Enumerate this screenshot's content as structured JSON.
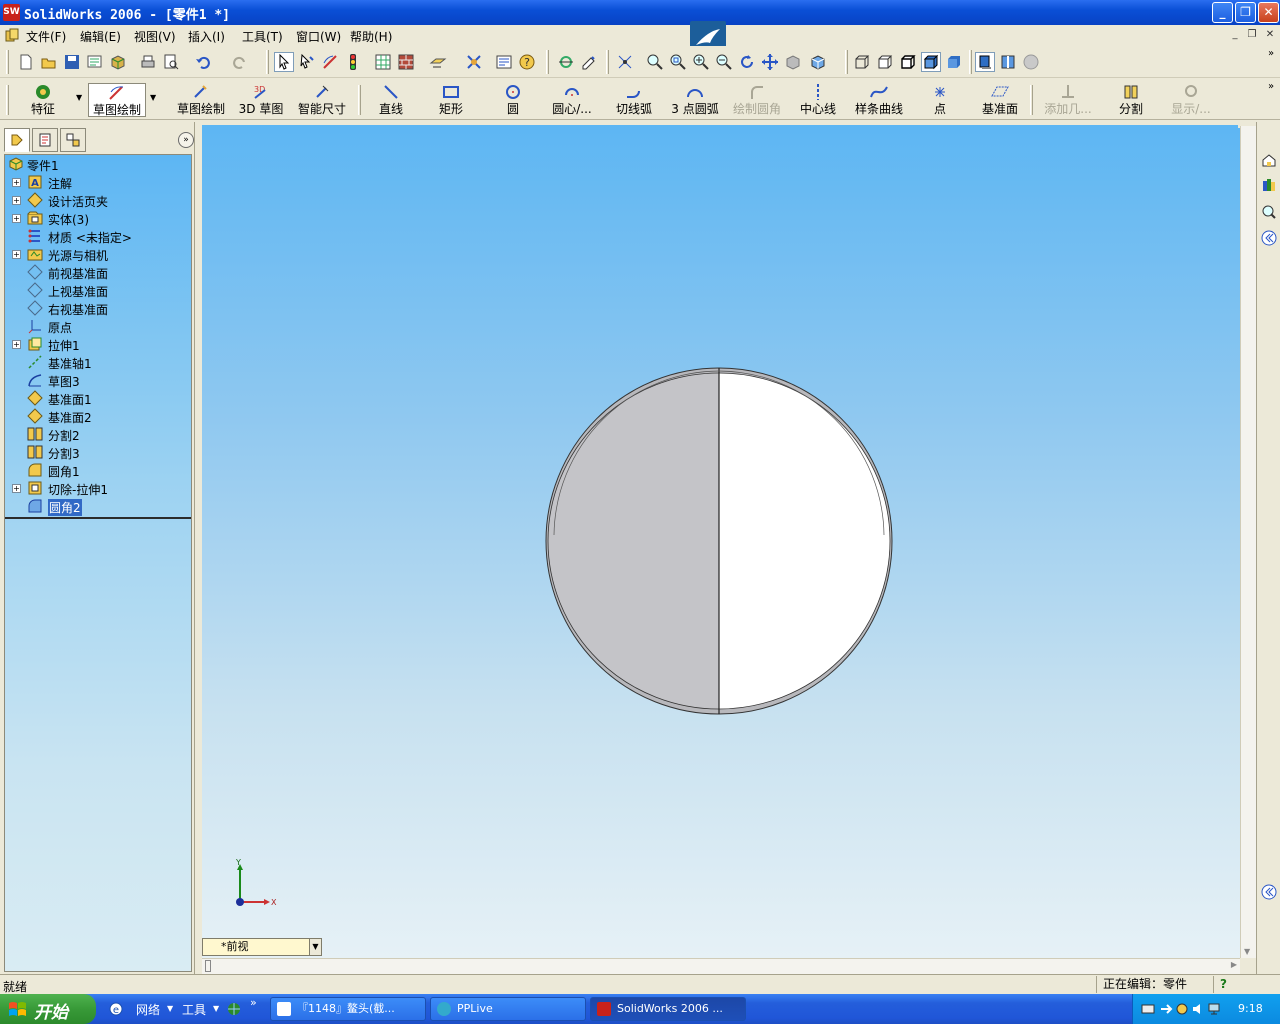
{
  "window": {
    "title": "SolidWorks 2006 - [零件1 *]",
    "logo_text": "SW"
  },
  "menu": {
    "items": [
      "文件(F)",
      "编辑(E)",
      "视图(V)",
      "插入(I)",
      "工具(T)",
      "窗口(W)",
      "帮助(H)"
    ]
  },
  "command_manager": {
    "buttons": [
      {
        "label": "特征",
        "enabled": true
      },
      {
        "label": "草图绘制",
        "enabled": true,
        "selected": true
      },
      {
        "label": "草图绘制",
        "enabled": true
      },
      {
        "label": "3D 草图",
        "enabled": true
      },
      {
        "label": "智能尺寸",
        "enabled": true
      },
      {
        "label": "直线",
        "enabled": true
      },
      {
        "label": "矩形",
        "enabled": true
      },
      {
        "label": "圆",
        "enabled": true
      },
      {
        "label": "圆心/...",
        "enabled": true
      },
      {
        "label": "切线弧",
        "enabled": true
      },
      {
        "label": "3 点圆弧",
        "enabled": true
      },
      {
        "label": "绘制圆角",
        "enabled": false
      },
      {
        "label": "中心线",
        "enabled": true
      },
      {
        "label": "样条曲线",
        "enabled": true
      },
      {
        "label": "点",
        "enabled": true
      },
      {
        "label": "基准面",
        "enabled": true
      },
      {
        "label": "添加几...",
        "enabled": false
      },
      {
        "label": "分割",
        "enabled": true
      },
      {
        "label": "显示/...",
        "enabled": false
      }
    ]
  },
  "feature_tree": {
    "root": "零件1",
    "items": [
      {
        "label": "注解",
        "expandable": true,
        "icon": "annotation-icon"
      },
      {
        "label": "设计活页夹",
        "expandable": true,
        "icon": "design-binder-icon"
      },
      {
        "label": "实体(3)",
        "expandable": true,
        "icon": "solid-bodies-icon"
      },
      {
        "label": "材质 <未指定>",
        "expandable": false,
        "icon": "material-icon"
      },
      {
        "label": "光源与相机",
        "expandable": true,
        "icon": "lights-camera-icon"
      },
      {
        "label": "前视基准面",
        "expandable": false,
        "icon": "plane-icon"
      },
      {
        "label": "上视基准面",
        "expandable": false,
        "icon": "plane-icon"
      },
      {
        "label": "右视基准面",
        "expandable": false,
        "icon": "plane-icon"
      },
      {
        "label": "原点",
        "expandable": false,
        "icon": "origin-icon"
      },
      {
        "label": "拉伸1",
        "expandable": true,
        "icon": "extrude-icon"
      },
      {
        "label": "基准轴1",
        "expandable": false,
        "icon": "axis-icon"
      },
      {
        "label": "草图3",
        "expandable": false,
        "icon": "sketch-icon"
      },
      {
        "label": "基准面1",
        "expandable": false,
        "icon": "ref-plane-icon"
      },
      {
        "label": "基准面2",
        "expandable": false,
        "icon": "ref-plane-icon"
      },
      {
        "label": "分割2",
        "expandable": false,
        "icon": "split-icon"
      },
      {
        "label": "分割3",
        "expandable": false,
        "icon": "split-icon"
      },
      {
        "label": "圆角1",
        "expandable": false,
        "icon": "fillet-icon"
      },
      {
        "label": "切除-拉伸1",
        "expandable": true,
        "icon": "cut-extrude-icon"
      },
      {
        "label": "圆角2",
        "expandable": false,
        "icon": "fillet-icon",
        "selected": true
      }
    ]
  },
  "viewport": {
    "view_name": "*前视",
    "axis_x": "X",
    "axis_y": "Y"
  },
  "status": {
    "left": "就绪",
    "right": "正在编辑：零件",
    "help": "?"
  },
  "taskbar": {
    "start": "开始",
    "quicklaunch": [
      "网络",
      "工具"
    ],
    "quicklaunch_more": "»",
    "tasks": [
      {
        "label": "『1148』鳌头(截...",
        "active": false
      },
      {
        "label": "PPLive",
        "active": false
      },
      {
        "label": "SolidWorks 2006 ...",
        "active": true
      }
    ],
    "clock": "9:18"
  },
  "colors": {
    "titlebar": "#0a4fd6",
    "viewport_top": "#5db6f3",
    "viewport_bottom": "#e6f1f6",
    "selection": "#3169c6",
    "part_shaded": "#c4c4c8",
    "part_light": "#ffffff"
  }
}
